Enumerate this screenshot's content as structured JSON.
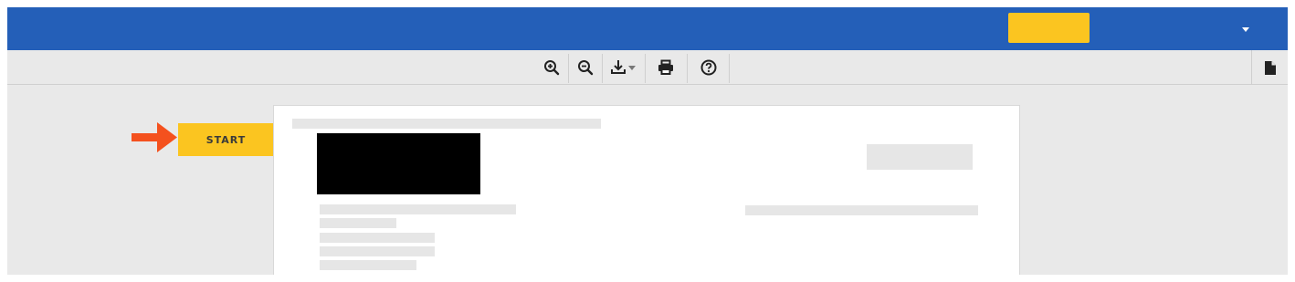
{
  "header": {
    "yellow_button_label": "",
    "menu_caret_icon": "caret-down-icon",
    "colors": {
      "bar": "#245fb8",
      "accent": "#fbc520"
    }
  },
  "toolbar": {
    "tools": [
      {
        "name": "zoom-in",
        "icon": "zoom-in-icon"
      },
      {
        "name": "zoom-out",
        "icon": "zoom-out-icon"
      },
      {
        "name": "download",
        "icon": "download-icon"
      },
      {
        "name": "print",
        "icon": "print-icon"
      },
      {
        "name": "help",
        "icon": "help-icon"
      }
    ],
    "side_icon": "document-icon"
  },
  "viewer": {
    "start_label": "START",
    "pointer_icon": "arrow-right-icon",
    "pointer_color": "#f4511e"
  }
}
